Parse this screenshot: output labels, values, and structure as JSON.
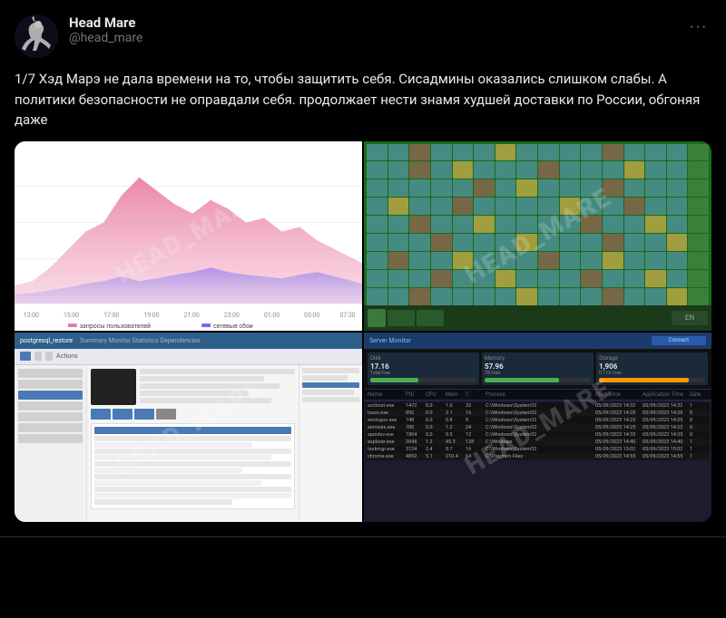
{
  "tweet": {
    "user": {
      "display_name": "Head Mare",
      "username": "@head_mare",
      "avatar_alt": "Head Mare avatar"
    },
    "more_options_label": "···",
    "text": "1/7 Хэд Марэ не дала времени          на то, чтобы защитить себя. Сисадмины оказались слишком слабы. А политики безопасности не оправдали себя.              продолжает нести знамя худшей доставки по России, обгоняя даже",
    "images": [
      {
        "type": "chart",
        "alt": "Traffic chart",
        "watermark": "HEAD_MARE"
      },
      {
        "type": "desktop",
        "alt": "Windows desktop screenshot",
        "watermark": "HEAD_MARE"
      },
      {
        "type": "dashboard",
        "alt": "Server dashboard",
        "watermark": "HEAD_MARE"
      },
      {
        "type": "server",
        "alt": "Server statistics",
        "watermark": "HEAD_MARE"
      }
    ],
    "stats": {
      "free_disk": "17.16 Total Free",
      "memory": "57.96 TB Free",
      "storage": "1,906 0.1 Fir Free"
    }
  }
}
